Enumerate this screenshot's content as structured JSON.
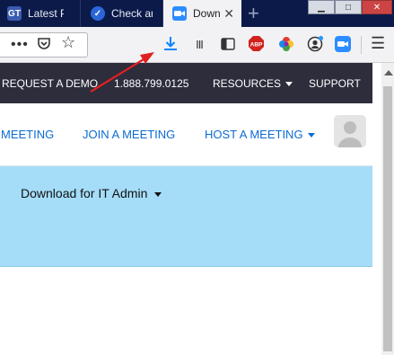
{
  "tabs": [
    {
      "label": "Latest Pe",
      "favicon": "GT"
    },
    {
      "label": "Check ar",
      "favicon": "check-badge"
    },
    {
      "label": "Down",
      "favicon": "zoom-camera",
      "active": true
    }
  ],
  "tab_close_glyph": "✕",
  "new_tab_glyph": "+",
  "window_controls": {
    "minimize": "▁",
    "maximize": "□",
    "close": "✕"
  },
  "toolbar": {
    "page_actions_glyph": "•••",
    "bookmark_star_glyph": "☆",
    "library_glyph": "III",
    "menu_glyph": "☰",
    "abp_text": "ABP"
  },
  "site_nav": {
    "request_demo": "REQUEST A DEMO",
    "phone": "1.888.799.0125",
    "resources": "RESOURCES",
    "support": "SUPPORT"
  },
  "menu": {
    "meeting": "MEETING",
    "join": "JOIN A MEETING",
    "host": "HOST A MEETING"
  },
  "banner": {
    "title": "Download for IT Admin"
  },
  "colors": {
    "tabbar": "#0c1a4a",
    "site_nav": "#2d2d3c",
    "link_blue": "#0b6bd3",
    "banner": "#a5ddf9",
    "annotation_red": "#e02020",
    "download_blue": "#0a84ff"
  }
}
